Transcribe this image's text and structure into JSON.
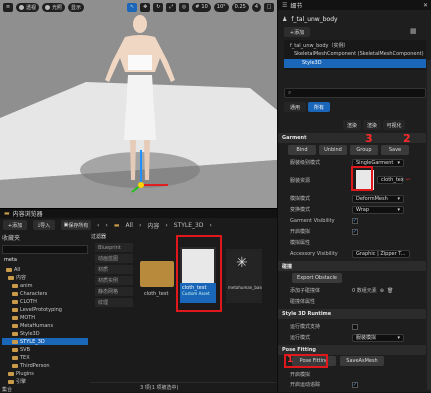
{
  "viewport": {
    "toolbar": [
      "透视",
      "光照",
      "显示"
    ],
    "grid_value": "10",
    "angle_value": "10°",
    "scale_value": "0.25",
    "camera_value": "4"
  },
  "details": {
    "tab_title": "细节",
    "actor_name": "f_tal_unw_body",
    "add_label": "+添加",
    "tree": [
      "f_tal_unw_body（实例）",
      "SkeletalMeshComponent (SkeletalMeshComponent)",
      "Style3D"
    ],
    "tabs": [
      "通用",
      "所有"
    ],
    "small_tabs": [
      "渲染",
      "渲染",
      "可视化"
    ],
    "sections": {
      "garment": "Garment",
      "collision": "碰撞",
      "runtime": "Style 3D Runtime",
      "posefit": "Pose Fitting"
    },
    "garment_buttons": [
      "Bind",
      "Unbind",
      "Group",
      "Save"
    ],
    "rows": {
      "lod": "服装级别模式",
      "lod_val": "SingleGarment",
      "asset": "服装资源",
      "asset_val": "cloth_tex",
      "mesh_mode": "模拟模式",
      "mesh_mode_val": "DeformMesh",
      "wrap": "变换模式",
      "wrap_val": "Wrap",
      "gv": "Garment Visibility",
      "open_sim": "开启模拟",
      "avatar": "模拟属性",
      "acc_vis": "Accessory Visibility",
      "acc_val": "Graphic | Zipper T...",
      "export_obstacle": "Export Obstacle",
      "add_obstacle": "添加子碰撞体",
      "add_obstacle_val": "0 数组元素",
      "extra": "碰撞体属性",
      "run_sim": "运行模式支持",
      "run_mode": "运行模式",
      "run_mode_val": "服装模拟",
      "pose_fitting_btn": "Pose Fitting",
      "save_as_mesh_btn": "SaveAsMesh",
      "sim_start": "开启模拟",
      "sim_track": "开启运动追踪"
    }
  },
  "content": {
    "tab_title": "内容浏览器",
    "add": "+添加",
    "import": "导入",
    "save_all": "保存所有",
    "path": [
      "All",
      "内容",
      "STYLE_3D"
    ],
    "favorites": "收藏夹",
    "root": "meta",
    "tree": [
      "All",
      "内容",
      "anim",
      "Characters",
      "CLOTH",
      "LevelPrototyping",
      "MOTH",
      "MetaHumans",
      "Style3D",
      "STYLE_3D",
      "SVB",
      "TEX",
      "ThirdPerson",
      "Plugins",
      "引擎"
    ],
    "filters_title": "过滤器",
    "filters": [
      "Blueprint",
      "动画蓝图",
      "材质",
      "材质实例",
      "静态网格",
      "纹理"
    ],
    "assets": [
      {
        "name": "cloth_test",
        "type": ""
      },
      {
        "name": "cloth_test",
        "type": "Custom Asset"
      },
      {
        "name": "metahuman_base_skel_lip",
        "type": ""
      }
    ],
    "status": "3 项(1 项被选中)",
    "collections": "集合"
  },
  "annotations": [
    "1",
    "2",
    "3"
  ],
  "colors": {
    "highlight": "#e0181b",
    "accent": "#1a66b8"
  }
}
